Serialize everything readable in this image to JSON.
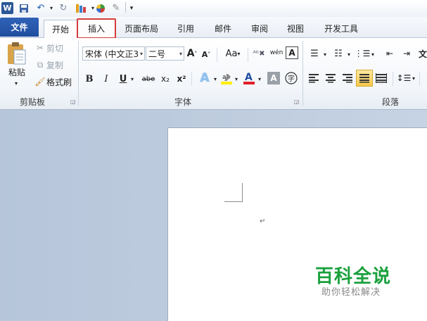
{
  "quick_access": {
    "app_icon": "word-icon",
    "save_icon": "save-icon",
    "undo_icon": "undo-icon",
    "redo_icon": "redo-icon",
    "customize_icon": "customize-qat-icon"
  },
  "tabs": [
    {
      "label": "文件"
    },
    {
      "label": "开始"
    },
    {
      "label": "插入"
    },
    {
      "label": "页面布局"
    },
    {
      "label": "引用"
    },
    {
      "label": "邮件"
    },
    {
      "label": "审阅"
    },
    {
      "label": "视图"
    },
    {
      "label": "开发工具"
    }
  ],
  "clipboard": {
    "paste": "粘贴",
    "cut": "剪切",
    "copy": "复制",
    "format_painter": "格式刷",
    "group": "剪贴板"
  },
  "font": {
    "font_name": "宋体 (中文正3",
    "font_size": "二号",
    "grow": "A",
    "shrink": "A",
    "change_case": "Aa",
    "bold": "B",
    "italic": "I",
    "underline": "U",
    "strike": "abe",
    "subscript": "x₂",
    "superscript": "x²",
    "group": "字体"
  },
  "paragraph": {
    "group": "段落"
  },
  "watermark": {
    "title": "百科全说",
    "subtitle": "助你轻松解决"
  },
  "colors": {
    "highlight_box": "#d43c3c",
    "file_tab": "#2f63b8",
    "watermark_green": "#1aa13d"
  }
}
